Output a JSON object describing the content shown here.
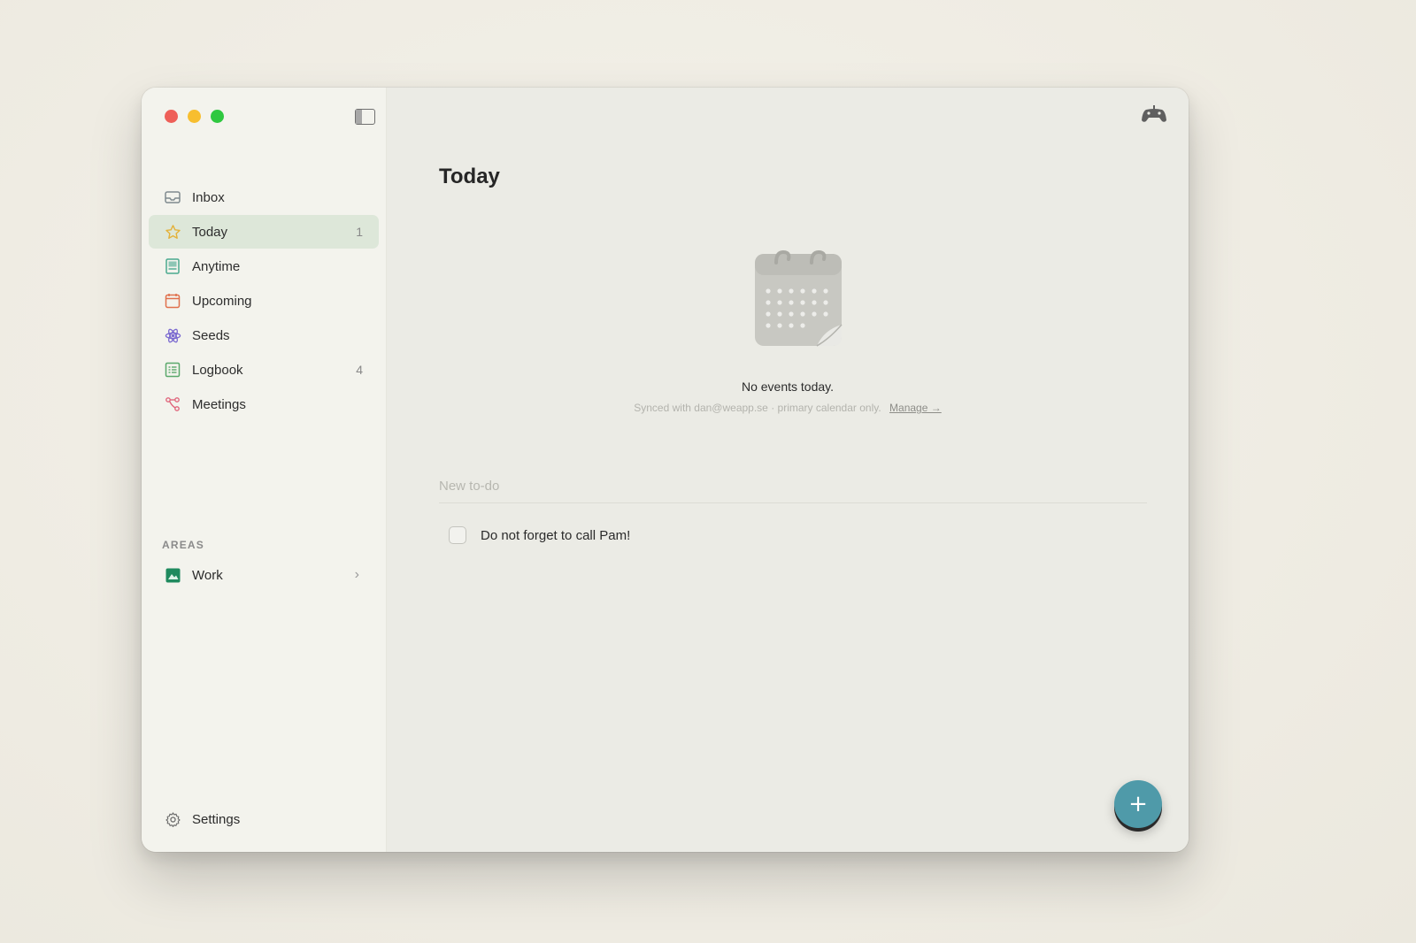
{
  "sidebar": {
    "items": [
      {
        "label": "Inbox",
        "count": "",
        "icon": "inbox-icon",
        "color": "#7f8a8f"
      },
      {
        "label": "Today",
        "count": "1",
        "icon": "star-icon",
        "color": "#e3b23c"
      },
      {
        "label": "Anytime",
        "count": "",
        "icon": "stack-icon",
        "color": "#4aa98f"
      },
      {
        "label": "Upcoming",
        "count": "",
        "icon": "calendar-icon",
        "color": "#e0704d"
      },
      {
        "label": "Seeds",
        "count": "",
        "icon": "seeds-icon",
        "color": "#7b6ad0"
      },
      {
        "label": "Logbook",
        "count": "4",
        "icon": "logbook-icon",
        "color": "#5aa86b"
      },
      {
        "label": "Meetings",
        "count": "",
        "icon": "meetings-icon",
        "color": "#e0667c"
      }
    ],
    "areas_header": "AREAS",
    "areas": [
      {
        "label": "Work",
        "icon": "area-icon",
        "color": "#1f8a5e"
      }
    ],
    "settings_label": "Settings"
  },
  "main": {
    "title": "Today",
    "empty_title": "No events today.",
    "sync_text": "Synced with dan@weapp.se · primary calendar only.",
    "manage_label": "Manage →",
    "new_todo_placeholder": "New to-do",
    "todos": [
      {
        "label": "Do not forget to call Pam!",
        "checked": false
      }
    ],
    "fab_label": "+"
  },
  "colors": {
    "accent": "#4f9aa9",
    "active_bg": "#dde7d9"
  }
}
